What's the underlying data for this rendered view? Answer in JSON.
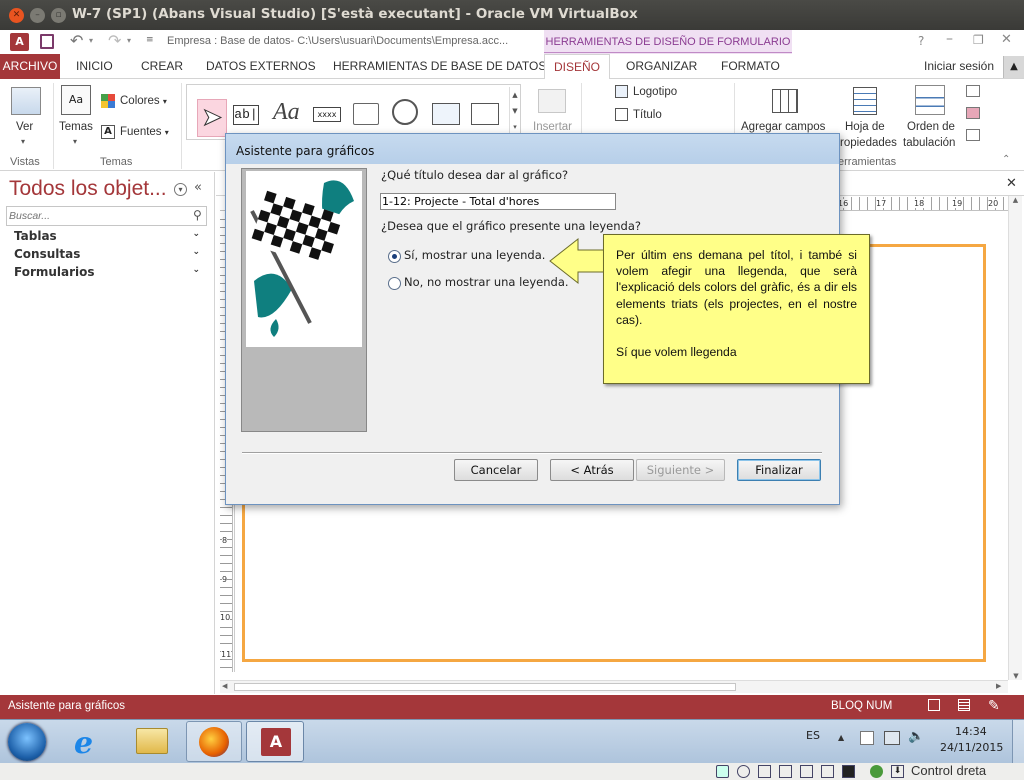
{
  "host": {
    "title": "W-7 (SP1) (Abans Visual Studio) [S'està executant] - Oracle VM VirtualBox"
  },
  "qat": {
    "app_icon": "A",
    "path": "Empresa : Base de datos- C:\\Users\\usuari\\Documents\\Empresa.acc...",
    "contextual_title": "HERRAMIENTAS DE DISEÑO DE FORMULARIO",
    "help": "?"
  },
  "tabs": [
    "ARCHIVO",
    "INICIO",
    "CREAR",
    "DATOS EXTERNOS",
    "HERRAMIENTAS DE BASE DE DATOS",
    "DISEÑO",
    "ORGANIZAR",
    "FORMATO"
  ],
  "signin": "Iniciar sesión",
  "ribbon": {
    "ver": "Ver",
    "temas": "Temas",
    "colores": "Colores",
    "fuentes": "Fuentes",
    "group_vistas": "Vistas",
    "group_temas": "Temas",
    "insertar": "Insertar",
    "logotipo": "Logotipo",
    "titulo": "Título",
    "agregar_campos": "Agregar campos",
    "hoja_prop_1": "Hoja de",
    "hoja_prop_2": "ropiedades",
    "orden_tab_1": "Orden de",
    "orden_tab_2": "tabulación",
    "group_herramientas": "erramientas"
  },
  "nav": {
    "title": "Todos los objet...",
    "search_placeholder": "Buscar...",
    "groups": [
      "Tablas",
      "Consultas",
      "Formularios"
    ]
  },
  "ruler": {
    "top": [
      "16",
      "17",
      "18",
      "19",
      "20"
    ],
    "left": [
      "8",
      "9",
      "10",
      "11"
    ]
  },
  "dialog": {
    "title": "Asistente para gráficos",
    "q_title": "¿Qué título desea dar al gráfico?",
    "title_value": "1-12: Projecte - Total d'hores",
    "q_legend": "¿Desea que el gráfico presente una leyenda?",
    "opt_yes": "Sí, mostrar una leyenda.",
    "opt_no": "No, no mostrar una leyenda.",
    "legend_selected": "yes",
    "btn_cancel": "Cancelar",
    "btn_back": "< Atrás",
    "btn_next": "Siguiente >",
    "btn_finish": "Finalizar"
  },
  "callout": {
    "paragraph1": "Per últim ens demana pel títol, i també si volem afegir una llegenda, que serà l'explicació dels colors del gràfic, és a dir els elements triats (els projectes, en el nostre cas).",
    "paragraph2": "Sí que volem llegenda"
  },
  "status": {
    "left": "Asistente para gráficos",
    "right": "BLOQ NUM"
  },
  "taskbar": {
    "lang": "ES",
    "time": "14:34",
    "date": "24/11/2015"
  },
  "vbox": {
    "host_key": "Control dreta"
  },
  "colors": {
    "access_red": "#a4373a",
    "contextual_purple": "#8b3c92",
    "callout_yellow": "#ffff88",
    "form_border_orange": "#f5a742"
  }
}
